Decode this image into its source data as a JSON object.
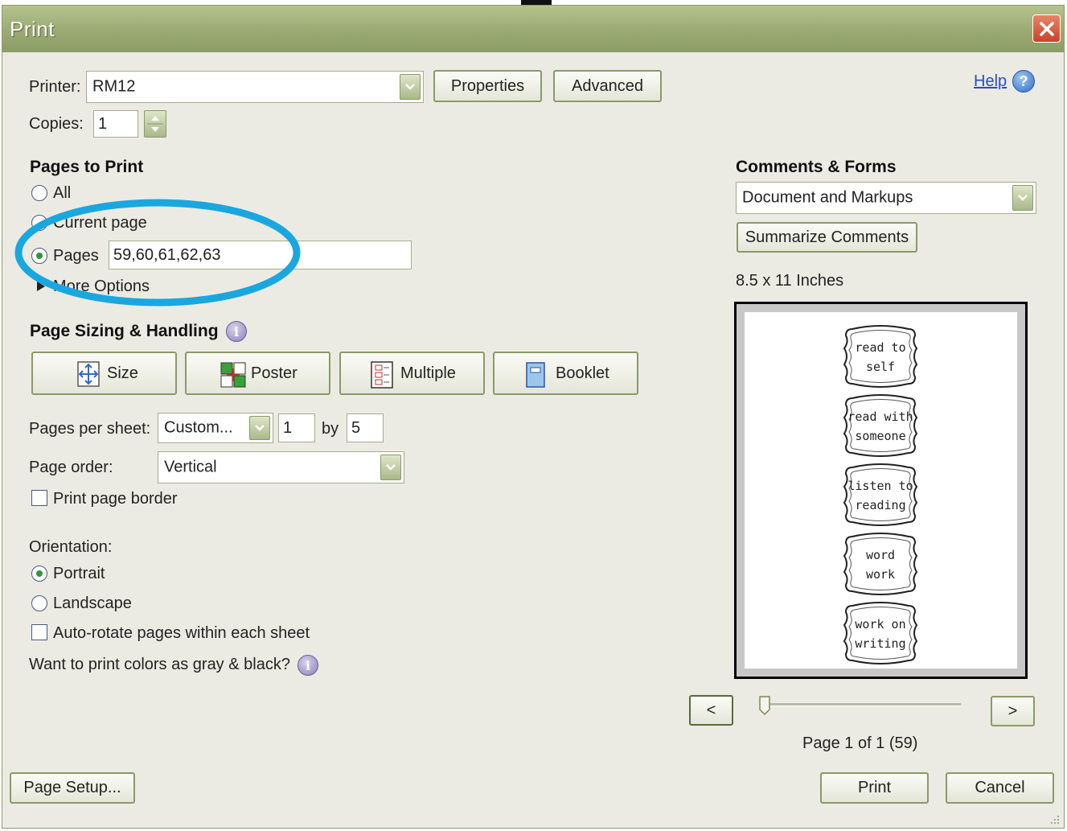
{
  "window": {
    "title": "Print"
  },
  "printer": {
    "label": "Printer:",
    "value": "RM12",
    "properties_label": "Properties",
    "advanced_label": "Advanced"
  },
  "help": {
    "label": "Help"
  },
  "copies": {
    "label": "Copies:",
    "value": "1"
  },
  "pages_to_print": {
    "heading": "Pages to Print",
    "all_label": "All",
    "current_label": "Current page",
    "pages_label": "Pages",
    "pages_value": "59,60,61,62,63",
    "more_options_label": "More Options",
    "selected": "pages"
  },
  "sizing": {
    "heading": "Page Sizing & Handling",
    "buttons": [
      "Size",
      "Poster",
      "Multiple",
      "Booklet"
    ],
    "pages_per_sheet_label": "Pages per sheet:",
    "pages_per_sheet_value": "Custom...",
    "rows": "1",
    "by_label": "by",
    "cols": "5",
    "page_order_label": "Page order:",
    "page_order_value": "Vertical",
    "print_border_label": "Print page border"
  },
  "orientation": {
    "heading": "Orientation:",
    "portrait_label": "Portrait",
    "landscape_label": "Landscape",
    "selected": "portrait",
    "autorotate_label": "Auto-rotate pages within each sheet"
  },
  "gray_label": "Want to print colors as gray & black?",
  "comments": {
    "heading": "Comments & Forms",
    "value": "Document and Markups",
    "summarize_label": "Summarize Comments"
  },
  "preview": {
    "size_label": "8.5 x 11 Inches",
    "labels": [
      [
        "read to",
        "self"
      ],
      [
        "read with",
        "someone"
      ],
      [
        "listen to",
        "reading"
      ],
      [
        "word",
        "work"
      ],
      [
        "work on",
        "writing"
      ]
    ],
    "prev_label": "<",
    "next_label": ">",
    "page_info": "Page 1 of 1 (59)"
  },
  "footer": {
    "page_setup_label": "Page Setup...",
    "print_label": "Print",
    "cancel_label": "Cancel"
  },
  "colors": {
    "accent": "#1aa7e0",
    "titlebar": "#9aaa72",
    "background": "#ecebe3"
  }
}
